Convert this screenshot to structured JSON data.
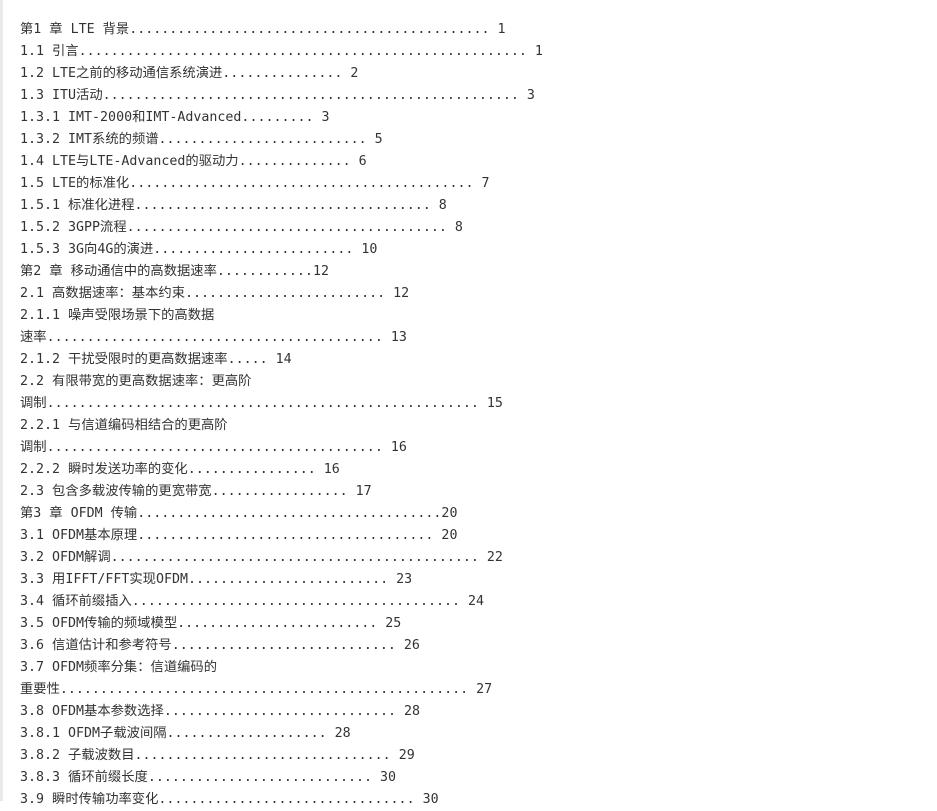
{
  "toc": {
    "lines": [
      "第1 章 LTE 背景............................................. 1",
      "1.1 引言........................................................ 1",
      "1.2 LTE之前的移动通信系统演进............... 2",
      "1.3 ITU活动.................................................... 3",
      "1.3.1 IMT-2000和IMT-Advanced......... 3",
      "1.3.2 IMT系统的频谱.......................... 5",
      "1.4 LTE与LTE-Advanced的驱动力.............. 6",
      "1.5 LTE的标准化........................................... 7",
      "1.5.1 标准化进程..................................... 8",
      "1.5.2 3GPP流程........................................ 8",
      "1.5.3 3G向4G的演进......................... 10",
      "第2 章 移动通信中的高数据速率............12",
      "2.1 高数据速率：基本约束......................... 12",
      "2.1.1 噪声受限场景下的高数据",
      "速率.......................................... 13",
      "2.1.2 干扰受限时的更高数据速率..... 14",
      "2.2 有限带宽的更高数据速率：更高阶",
      "调制...................................................... 15",
      "2.2.1 与信道编码相结合的更高阶",
      "调制.......................................... 16",
      "2.2.2 瞬时发送功率的变化................ 16",
      "2.3 包含多载波传输的更宽带宽................. 17",
      "第3 章 OFDM 传输......................................20",
      "3.1 OFDM基本原理..................................... 20",
      "3.2 OFDM解调.............................................. 22",
      "3.3 用IFFT/FFT实现OFDM......................... 23",
      "3.4 循环前缀插入......................................... 24",
      "3.5 OFDM传输的频域模型......................... 25",
      "3.6 信道估计和参考符号............................ 26",
      "3.7 OFDM频率分集：信道编码的",
      "重要性................................................... 27",
      "3.8 OFDM基本参数选择............................. 28",
      "3.8.1 OFDM子载波间隔.................... 28",
      "3.8.2 子载波数目................................ 29",
      "3.8.3 循环前缀长度............................ 30",
      "3.9 瞬时传输功率变化................................ 30"
    ]
  }
}
